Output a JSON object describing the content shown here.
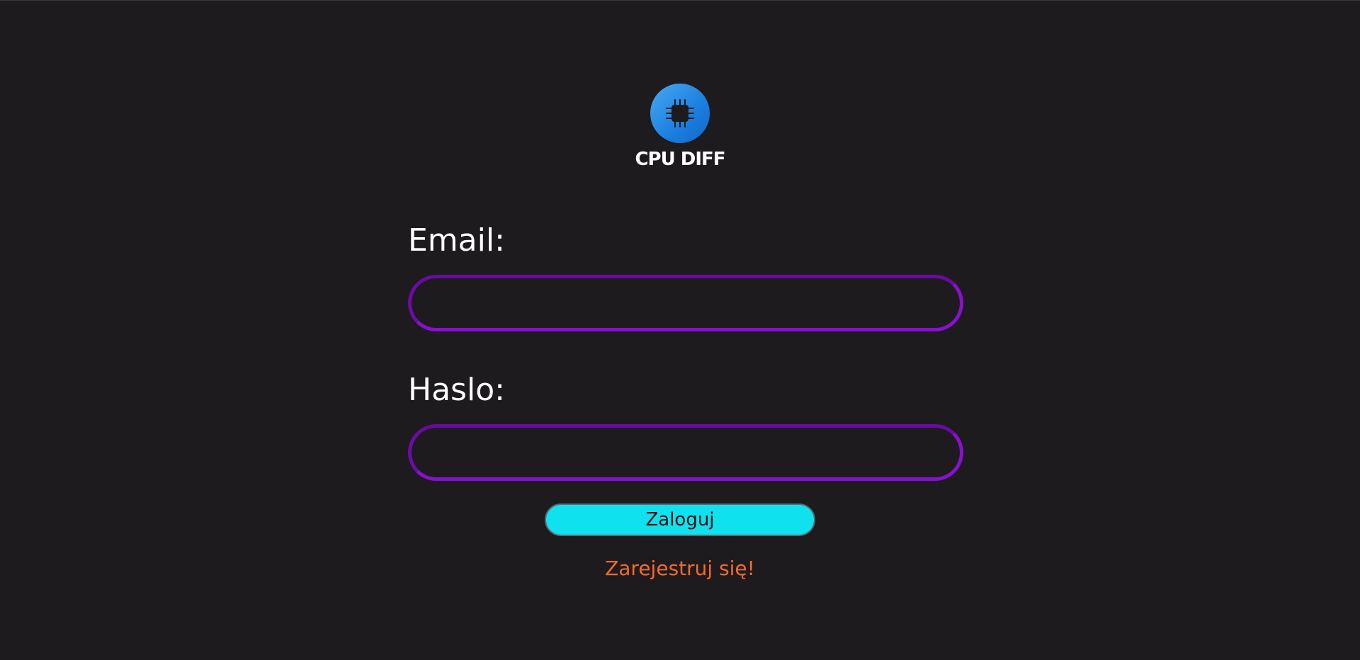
{
  "brand": {
    "name": "CPU DIFF",
    "logo_icon": "cpu-chip-icon",
    "logo_color": "#1a7fe0"
  },
  "form": {
    "email_label": "Email:",
    "email_value": "",
    "password_label": "Haslo:",
    "password_value": "",
    "field_border_color": "#8a0fd0"
  },
  "actions": {
    "login_label": "Zaloguj",
    "login_color": "#0fe2ee",
    "register_label": "Zarejestruj się!",
    "register_color": "#f26a2b"
  }
}
